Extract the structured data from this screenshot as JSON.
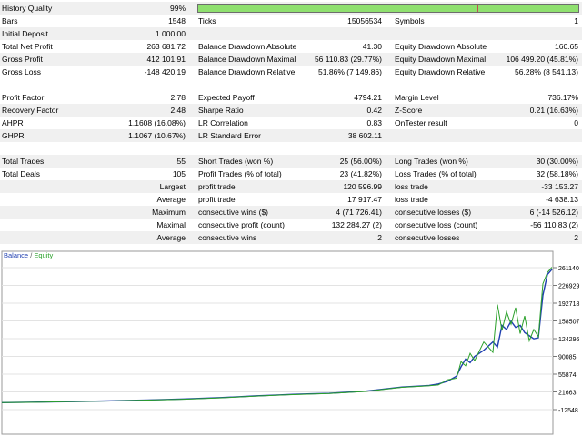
{
  "history_quality": {
    "label": "History Quality",
    "value": "99%",
    "fraction": 0.99
  },
  "stats_top": [
    {
      "c1": "Bars",
      "v1": "1548",
      "c2": "Ticks",
      "v2": "15056534",
      "c3": "Symbols",
      "v3": "1"
    },
    {
      "c1": "Initial Deposit",
      "v1": "1 000.00",
      "c2": "",
      "v2": "",
      "c3": "",
      "v3": ""
    },
    {
      "c1": "Total Net Profit",
      "v1": "263 681.72",
      "c2": "Balance Drawdown Absolute",
      "v2": "41.30",
      "c3": "Equity Drawdown Absolute",
      "v3": "160.65"
    },
    {
      "c1": "Gross Profit",
      "v1": "412 101.91",
      "c2": "Balance Drawdown Maximal",
      "v2": "56 110.83 (29.77%)",
      "c3": "Equity Drawdown Maximal",
      "v3": "106 499.20 (45.81%)"
    },
    {
      "c1": "Gross Loss",
      "v1": "-148 420.19",
      "c2": "Balance Drawdown Relative",
      "v2": "51.86% (7 149.86)",
      "c3": "Equity Drawdown Relative",
      "v3": "56.28% (8 541.13)"
    }
  ],
  "stats_mid": [
    {
      "c1": "Profit Factor",
      "v1": "2.78",
      "c2": "Expected Payoff",
      "v2": "4794.21",
      "c3": "Margin Level",
      "v3": "736.17%"
    },
    {
      "c1": "Recovery Factor",
      "v1": "2.48",
      "c2": "Sharpe Ratio",
      "v2": "0.42",
      "c3": "Z-Score",
      "v3": "0.21 (16.63%)"
    },
    {
      "c1": "AHPR",
      "v1": "1.1608 (16.08%)",
      "c2": "LR Correlation",
      "v2": "0.83",
      "c3": "OnTester result",
      "v3": "0"
    },
    {
      "c1": "GHPR",
      "v1": "1.1067 (10.67%)",
      "c2": "LR Standard Error",
      "v2": "38 602.11",
      "c3": "",
      "v3": ""
    }
  ],
  "stats_trades": [
    {
      "c1": "Total Trades",
      "v1": "55",
      "c2": "Short Trades (won %)",
      "v2": "25 (56.00%)",
      "c3": "Long Trades (won %)",
      "v3": "30 (30.00%)"
    },
    {
      "c1": "Total Deals",
      "v1": "105",
      "c2": "Profit Trades (% of total)",
      "v2": "23 (41.82%)",
      "c3": "Loss Trades (% of total)",
      "v3": "32 (58.18%)"
    }
  ],
  "stats_bottom": [
    {
      "c1": "Largest",
      "c2": "profit trade",
      "v2": "120 596.99",
      "c3": "loss trade",
      "v3": "-33 153.27"
    },
    {
      "c1": "Average",
      "c2": "profit trade",
      "v2": "17 917.47",
      "c3": "loss trade",
      "v3": "-4 638.13"
    },
    {
      "c1": "Maximum",
      "c2": "consecutive wins ($)",
      "v2": "4 (71 726.41)",
      "c3": "consecutive losses ($)",
      "v3": "6 (-14 526.12)"
    },
    {
      "c1": "Maximal",
      "c2": "consecutive profit (count)",
      "v2": "132 284.27 (2)",
      "c3": "consecutive loss (count)",
      "v3": "-56 110.83 (2)"
    },
    {
      "c1": "Average",
      "c2": "consecutive wins",
      "v2": "2",
      "c3": "consecutive losses",
      "v3": "2"
    }
  ],
  "chart_data": {
    "type": "line",
    "legend": {
      "balance": "Balance",
      "separator": " / ",
      "equity": "Equity"
    },
    "yticks": [
      "261140",
      "226929",
      "192718",
      "158507",
      "124296",
      "90085",
      "55874",
      "21663",
      "-12548"
    ],
    "ylim": [
      -12548,
      261140
    ],
    "colors": {
      "balance": "#1f3fb0",
      "equity": "#2aa02a"
    },
    "series": [
      {
        "key": "balance",
        "x": [
          0,
          40,
          80,
          120,
          160,
          200,
          240,
          280,
          300,
          320,
          340,
          360,
          380,
          400,
          420,
          440,
          460,
          470,
          480,
          490,
          500,
          505,
          510,
          515,
          520,
          530,
          540,
          545,
          550,
          555,
          560,
          565,
          570,
          575,
          580,
          585,
          590,
          595,
          600,
          605
        ],
        "values": [
          1000,
          2000,
          3000,
          4500,
          6000,
          8000,
          10500,
          14000,
          15500,
          17000,
          18000,
          19000,
          21000,
          23000,
          27000,
          31000,
          33000,
          34000,
          37000,
          42000,
          52000,
          70000,
          85000,
          78000,
          90000,
          102000,
          118000,
          108000,
          150000,
          142000,
          158000,
          146000,
          150000,
          136000,
          130000,
          124000,
          126000,
          208000,
          248000,
          258000
        ]
      },
      {
        "key": "equity",
        "x": [
          0,
          40,
          80,
          120,
          160,
          200,
          240,
          280,
          300,
          320,
          340,
          360,
          380,
          400,
          420,
          440,
          460,
          470,
          480,
          490,
          500,
          505,
          510,
          515,
          520,
          530,
          540,
          545,
          550,
          555,
          560,
          565,
          570,
          575,
          580,
          585,
          590,
          595,
          600,
          605
        ],
        "values": [
          1000,
          1800,
          3200,
          4200,
          5800,
          7500,
          10000,
          13500,
          15000,
          16500,
          17500,
          18500,
          20500,
          22500,
          26500,
          30500,
          32500,
          33500,
          35000,
          45000,
          48000,
          80000,
          72000,
          96000,
          82000,
          118000,
          98000,
          190000,
          140000,
          176000,
          152000,
          184000,
          134000,
          168000,
          120000,
          142000,
          128000,
          230000,
          252000,
          262000
        ]
      }
    ]
  }
}
